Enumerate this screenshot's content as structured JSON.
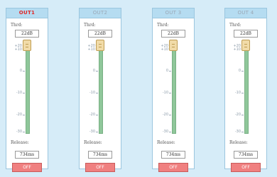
{
  "outputs": [
    {
      "name": "OUT1",
      "active": true,
      "thrd_label": "Thrd:",
      "thrd_value": "22dB",
      "ticks": [
        "+20",
        "+10",
        "0",
        "-10",
        "-20",
        "-30"
      ],
      "release_label": "Release:",
      "release_value": "734ms",
      "off_label": "OFF"
    },
    {
      "name": "OUT2",
      "active": false,
      "thrd_label": "Thrd:",
      "thrd_value": "22dB",
      "ticks": [
        "+20",
        "+10",
        "0",
        "-10",
        "-20",
        "-30"
      ],
      "release_label": "Release:",
      "release_value": "734ms",
      "off_label": "OFF"
    },
    {
      "name": "OUT 3",
      "active": false,
      "thrd_label": "Thrd:",
      "thrd_value": "22dB",
      "ticks": [
        "+20",
        "+10",
        "0",
        "-10",
        "-20",
        "-30"
      ],
      "release_label": "Release:",
      "release_value": "734ms",
      "off_label": "OFF"
    },
    {
      "name": "OUT 4",
      "active": false,
      "thrd_label": "Thrd:",
      "thrd_value": "22dB",
      "ticks": [
        "+20",
        "+10",
        "0",
        "-10",
        "-20",
        "-30"
      ],
      "release_label": "Release:",
      "release_value": "734ms",
      "off_label": "OFF"
    }
  ],
  "colors": {
    "background": "#d6ecf8",
    "header": "#b5dcf1",
    "active_title": "#e02828",
    "inactive_title": "#9aa8b6",
    "track": "#8fc79a",
    "knob": "#f1dba8",
    "off_button": "#f08080"
  }
}
